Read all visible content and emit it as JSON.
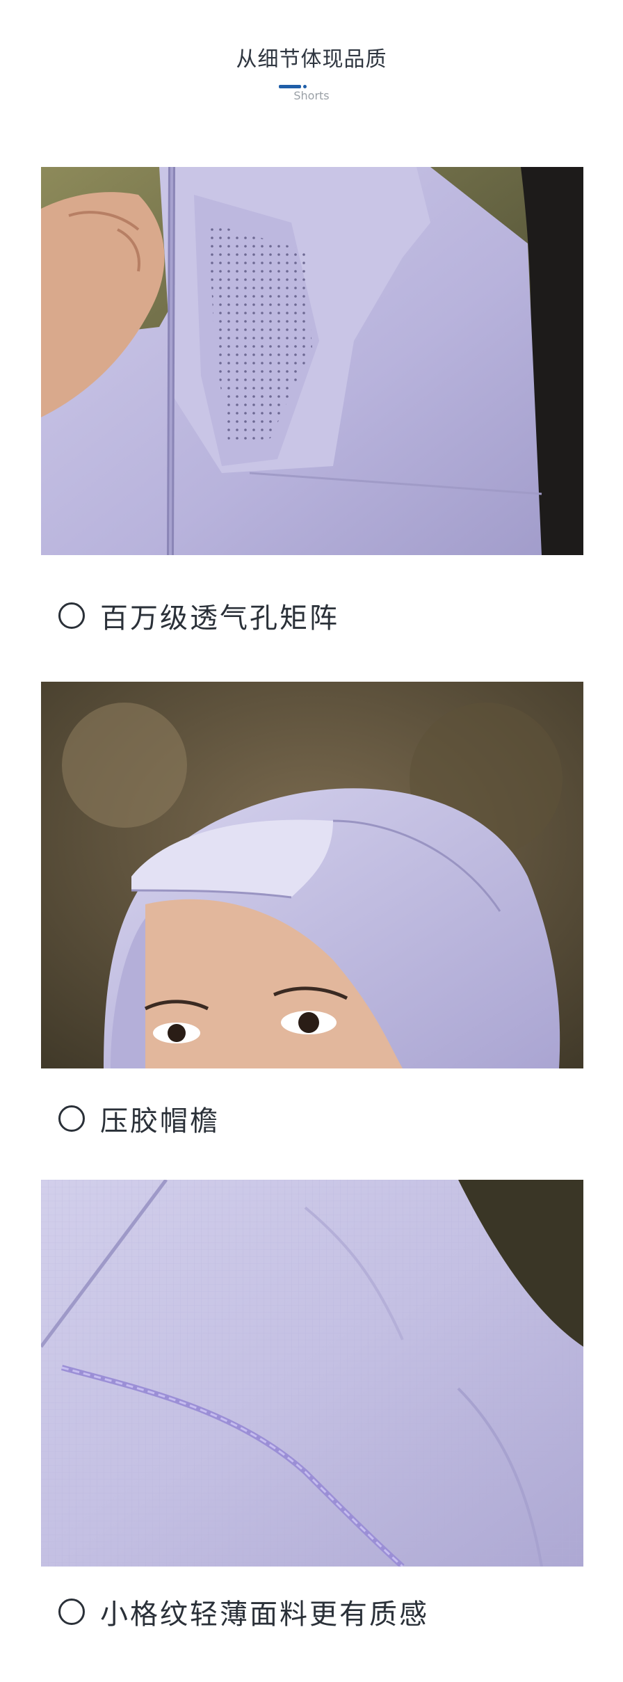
{
  "header": {
    "title": "从细节体现品质",
    "subtitle": "Shorts",
    "accent_color": "#1f5ea8"
  },
  "features": [
    {
      "caption": "百万级透气孔矩阵",
      "image": "jacket-collar-perforated-vent-photo"
    },
    {
      "caption": "压胶帽檐",
      "image": "hood-brim-closeup-photo"
    },
    {
      "caption": "小格纹轻薄面料更有质感",
      "image": "ripstop-fabric-closeup-photo"
    }
  ],
  "colors": {
    "fabric": "#c3bfe0",
    "text": "#2a3038"
  }
}
